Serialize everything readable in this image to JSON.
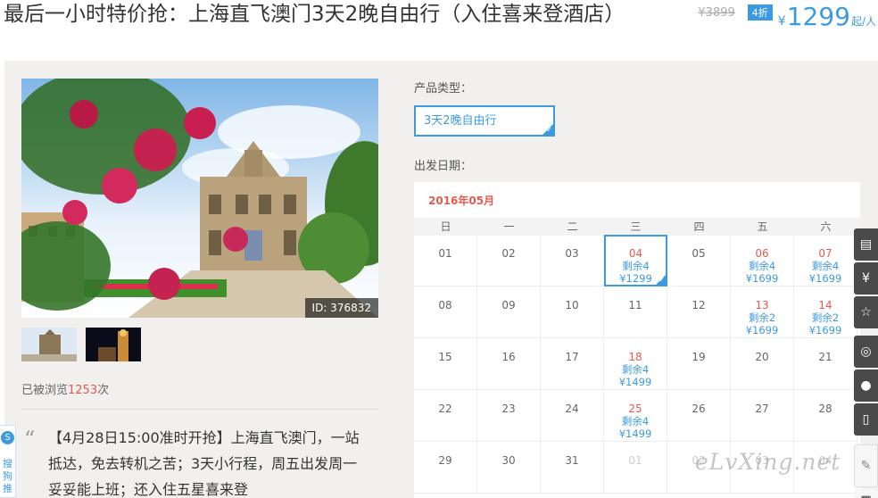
{
  "header": {
    "title": "最后一小时特价抢：上海直飞澳门3天2晚自由行（入住喜来登酒店）",
    "original_price": "¥3899",
    "discount": "4折",
    "currency": "¥",
    "price": "1299",
    "price_unit": "起/人"
  },
  "gallery": {
    "photo_id": "ID: 376832",
    "thumbnails": [
      "thumbnail-ruins",
      "thumbnail-night"
    ]
  },
  "stats": {
    "views_prefix": "已被浏览",
    "views_count": "1253",
    "views_suffix": "次"
  },
  "description": {
    "quote": "“",
    "text": "【4月28日15:00准时开抢】上海直飞澳门，一站抵达，免去转机之苦；3天小行程，周五出发周一妥妥能上班；还入住五星喜来登"
  },
  "left_float": {
    "icon": "S",
    "text": "搜狗推"
  },
  "product": {
    "type_label": "产品类型：",
    "type_value": "3天2晚自由行"
  },
  "calendar": {
    "label": "出发日期：",
    "month": "2016年05月",
    "weekdays": [
      "日",
      "一",
      "二",
      "三",
      "四",
      "五",
      "六"
    ],
    "days": [
      {
        "d": "01"
      },
      {
        "d": "02"
      },
      {
        "d": "03"
      },
      {
        "d": "04",
        "stock": "剩余4",
        "price": "¥1299",
        "special": true,
        "selected": true
      },
      {
        "d": "05"
      },
      {
        "d": "06",
        "stock": "剩余4",
        "price": "¥1699",
        "special": true
      },
      {
        "d": "07",
        "stock": "剩余4",
        "price": "¥1699",
        "special": true
      },
      {
        "d": "08"
      },
      {
        "d": "09"
      },
      {
        "d": "10"
      },
      {
        "d": "11"
      },
      {
        "d": "12"
      },
      {
        "d": "13",
        "stock": "剩余2",
        "price": "¥1699",
        "special": true
      },
      {
        "d": "14",
        "stock": "剩余2",
        "price": "¥1699",
        "special": true
      },
      {
        "d": "15"
      },
      {
        "d": "16"
      },
      {
        "d": "17"
      },
      {
        "d": "18",
        "stock": "剩余4",
        "price": "¥1499",
        "special": true
      },
      {
        "d": "19"
      },
      {
        "d": "20"
      },
      {
        "d": "21"
      },
      {
        "d": "22"
      },
      {
        "d": "23"
      },
      {
        "d": "24"
      },
      {
        "d": "25",
        "stock": "剩余4",
        "price": "¥1499",
        "special": true
      },
      {
        "d": "26"
      },
      {
        "d": "27"
      },
      {
        "d": "28"
      },
      {
        "d": "29"
      },
      {
        "d": "30"
      },
      {
        "d": "31"
      },
      {
        "d": "01",
        "faded": true
      },
      {
        "d": "02",
        "faded": true
      },
      {
        "d": "03",
        "faded": true
      },
      {
        "d": "04",
        "faded": true
      }
    ]
  },
  "watermark": "eLvXing.net",
  "side_bar": [
    {
      "name": "order-icon",
      "glyph": "▤"
    },
    {
      "name": "yen-icon",
      "glyph": "¥"
    },
    {
      "name": "star-icon",
      "glyph": "☆"
    },
    {
      "name": "weibo-icon",
      "glyph": "◎"
    },
    {
      "name": "wechat-icon",
      "glyph": "●"
    },
    {
      "name": "mobile-icon",
      "glyph": "▯"
    },
    {
      "name": "pen-icon",
      "glyph": "✎"
    },
    {
      "name": "qrcode-icon",
      "glyph": "▦"
    }
  ]
}
